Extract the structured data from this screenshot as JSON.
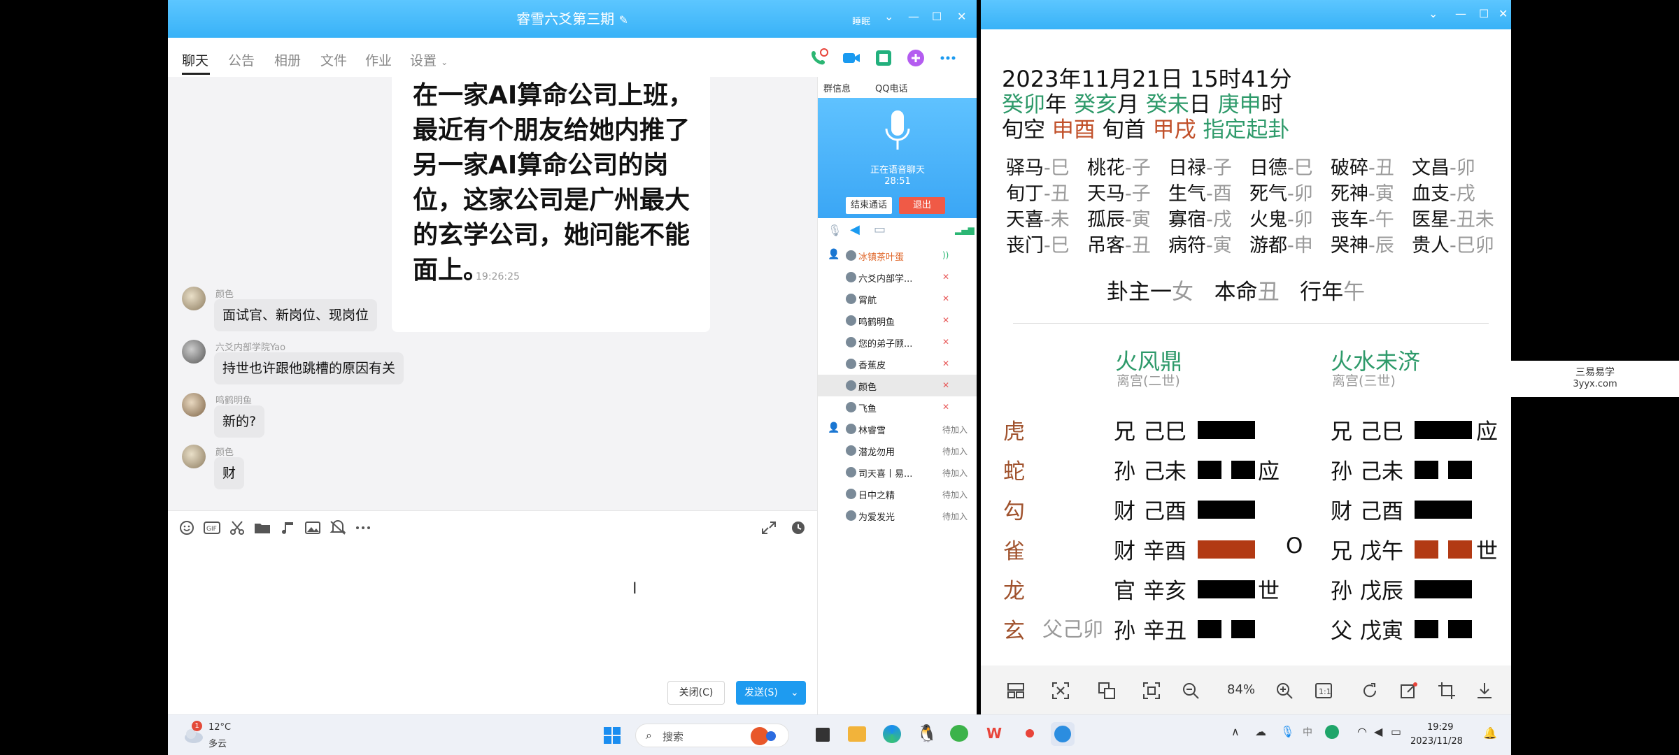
{
  "qq": {
    "title": "睿雪六爻第三期",
    "window_hint": "睡眠",
    "tabs": [
      "聊天",
      "公告",
      "相册",
      "文件",
      "作业",
      "设置"
    ],
    "quoted_message": "在一家AI算命公司上班，最近有个朋友给她内推了另一家AI算命公司的岗位，这家公司是广州最大的玄学公司，她问能不能面上。",
    "timestamp": "19:26:25",
    "messages": [
      {
        "sender": "颜色",
        "text": "面试官、新岗位、现岗位"
      },
      {
        "sender": "六爻内部学院Yao",
        "text": "持世也许跟他跳槽的原因有关"
      },
      {
        "sender": "鸣鹤明鱼",
        "text": "新的?"
      },
      {
        "sender": "颜色",
        "text": "财"
      }
    ],
    "close_label": "关闭(C)",
    "send_label": "发送(S)",
    "side_tabs": [
      "群信息",
      "QQ电话"
    ],
    "voice_status": "正在语音聊天",
    "voice_time": "28:51",
    "end_call_label": "结束通话",
    "exit_label": "退出",
    "members": [
      {
        "name": "冰镇茶叶蛋",
        "status": ""
      },
      {
        "name": "六爻内部学...",
        "status": ""
      },
      {
        "name": "霄航",
        "status": ""
      },
      {
        "name": "鸣鹤明鱼",
        "status": ""
      },
      {
        "name": "您的弟子顾...",
        "status": ""
      },
      {
        "name": "香蕉皮",
        "status": ""
      },
      {
        "name": "颜色",
        "status": ""
      },
      {
        "name": "飞鱼",
        "status": ""
      },
      {
        "name": "林睿雪",
        "status": "待加入"
      },
      {
        "name": "潜龙勿用",
        "status": "待加入"
      },
      {
        "name": "司天喜丨易...",
        "status": "待加入"
      },
      {
        "name": "日中之精",
        "status": "待加入"
      },
      {
        "name": "为爱发光",
        "status": "待加入"
      }
    ]
  },
  "viewer": {
    "datetime": "2023年11月21日 15时41分",
    "ganzhi": [
      {
        "gz": "癸卯",
        "unit": "年"
      },
      {
        "gz": "癸亥",
        "unit": "月"
      },
      {
        "gz": "癸未",
        "unit": "日"
      },
      {
        "gz": "庚申",
        "unit": "时"
      }
    ],
    "xunkong_label": "旬空",
    "xunkong": "申酉",
    "xunshou_label": "旬首",
    "xunshou": "甲戌",
    "method": "指定起卦",
    "shensha": [
      [
        "驿马",
        "巳"
      ],
      [
        "桃花",
        "子"
      ],
      [
        "日禄",
        "子"
      ],
      [
        "日德",
        "巳"
      ],
      [
        "破碎",
        "丑"
      ],
      [
        "文昌",
        "卯"
      ],
      [
        "旬丁",
        "丑"
      ],
      [
        "天马",
        "子"
      ],
      [
        "生气",
        "酉"
      ],
      [
        "死气",
        "卯"
      ],
      [
        "死神",
        "寅"
      ],
      [
        "血支",
        "戌"
      ],
      [
        "天喜",
        "未"
      ],
      [
        "孤辰",
        "寅"
      ],
      [
        "寡宿",
        "戌"
      ],
      [
        "火鬼",
        "卯"
      ],
      [
        "丧车",
        "午"
      ],
      [
        "医星",
        "丑未"
      ],
      [
        "丧门",
        "巳"
      ],
      [
        "吊客",
        "丑"
      ],
      [
        "病符",
        "寅"
      ],
      [
        "游都",
        "申"
      ],
      [
        "哭神",
        "辰"
      ],
      [
        "贵人",
        "巳卯"
      ]
    ],
    "guazhu_label": "卦主一",
    "guazhu": "女",
    "benming_label": "本命",
    "benming": "丑",
    "xingnian_label": "行年",
    "xingnian": "午",
    "gua_main": {
      "name": "火风鼎",
      "palace": "离宫(二世)"
    },
    "gua_change": {
      "name": "火水未济",
      "palace": "离宫(三世)"
    },
    "liushen": [
      "虎",
      "蛇",
      "勾",
      "雀",
      "龙",
      "玄"
    ],
    "fushen": "父己卯",
    "lines_main": [
      {
        "liuqin": "兄",
        "ganzhi": "己巳",
        "yang": true,
        "moving": false,
        "mark": ""
      },
      {
        "liuqin": "孙",
        "ganzhi": "己未",
        "yang": false,
        "moving": false,
        "mark": "应"
      },
      {
        "liuqin": "财",
        "ganzhi": "己酉",
        "yang": true,
        "moving": false,
        "mark": ""
      },
      {
        "liuqin": "财",
        "ganzhi": "辛酉",
        "yang": true,
        "moving": true,
        "mark": "O"
      },
      {
        "liuqin": "官",
        "ganzhi": "辛亥",
        "yang": true,
        "moving": false,
        "mark": "世"
      },
      {
        "liuqin": "孙",
        "ganzhi": "辛丑",
        "yang": false,
        "moving": false,
        "mark": ""
      }
    ],
    "lines_change": [
      {
        "liuqin": "兄",
        "ganzhi": "己巳",
        "yang": true,
        "moving": false,
        "mark": "应"
      },
      {
        "liuqin": "孙",
        "ganzhi": "己未",
        "yang": false,
        "moving": false,
        "mark": ""
      },
      {
        "liuqin": "财",
        "ganzhi": "己酉",
        "yang": true,
        "moving": false,
        "mark": ""
      },
      {
        "liuqin": "兄",
        "ganzhi": "戊午",
        "yang": false,
        "moving": true,
        "mark": "世"
      },
      {
        "liuqin": "孙",
        "ganzhi": "戊辰",
        "yang": true,
        "moving": false,
        "mark": ""
      },
      {
        "liuqin": "父",
        "ganzhi": "戊寅",
        "yang": false,
        "moving": false,
        "mark": ""
      }
    ],
    "zoom": "84%"
  },
  "watermark": {
    "line1": "三易易学",
    "line2": "3yyx.com"
  },
  "taskbar": {
    "weather_temp": "12°C",
    "weather_desc": "多云",
    "weather_badge": "1",
    "search_placeholder": "搜索",
    "time": "19:29",
    "date": "2023/11/28"
  }
}
